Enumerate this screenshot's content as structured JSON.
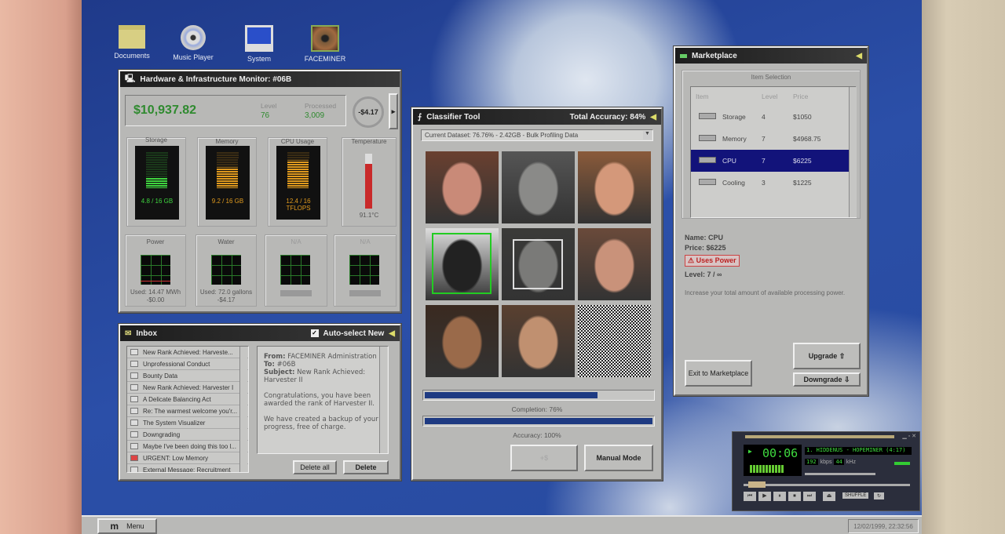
{
  "desktop": {
    "icons": [
      {
        "label": "Documents",
        "icon": "folder-icon"
      },
      {
        "label": "Music Player",
        "icon": "cd-icon"
      },
      {
        "label": "System",
        "icon": "computer-icon"
      },
      {
        "label": "FACEMINER",
        "icon": "eye-icon"
      }
    ]
  },
  "hardware": {
    "title": "Hardware & Infrastructure Monitor: #06B",
    "balance": "$10,937.82",
    "level_label": "Level",
    "level": "76",
    "processed_label": "Processed",
    "processed": "3,009",
    "rate": "-$4.17",
    "meters": [
      {
        "label": "Storage",
        "value": "4.8 / 16 GB",
        "fraction": 0.3,
        "color": "#3fd43f"
      },
      {
        "label": "Memory",
        "value": "9.2 / 16 GB",
        "fraction": 0.575,
        "color": "#e09a1e"
      },
      {
        "label": "CPU Usage",
        "value": "12.4 / 16 TFLOPS",
        "fraction": 0.775,
        "color": "#e09a1e"
      }
    ],
    "temperature": {
      "label": "Temperature",
      "value": "91.1°C",
      "fraction": 0.82
    },
    "graphs": [
      {
        "label": "Power",
        "line1": "Used: 14.47 MWh",
        "line2": "-$0.00"
      },
      {
        "label": "Water",
        "line1": "Used: 72.0 gallons",
        "line2": "-$4.17"
      },
      {
        "label": "N/A"
      },
      {
        "label": "N/A"
      }
    ]
  },
  "inbox": {
    "title": "Inbox",
    "auto_select": "Auto-select New",
    "auto_checked": true,
    "messages": [
      "New Rank Achieved: Harveste...",
      "Unprofessional Conduct",
      "Bounty Data",
      "New Rank Achieved: Harvester I",
      "A Delicate Balancing Act",
      "Re: The warmest welcome you'r...",
      "The System Visualizer",
      "Downgrading",
      "Maybe I've been doing this too l...",
      "URGENT: Low Memory",
      "External Message: Recruitment"
    ],
    "reader": {
      "from_label": "From:",
      "from": "FACEMINER Administration",
      "to_label": "To:",
      "to": "#06B",
      "subject_label": "Subject:",
      "subject": "New Rank Achieved: Harvester II",
      "body1": "Congratulations, you have been awarded the rank of Harvester II.",
      "body2": "We have created a backup of your progress, free of charge."
    },
    "delete_all": "Delete all",
    "delete": "Delete"
  },
  "classifier": {
    "title": "Classifier Tool",
    "accuracy_total": "Total Accuracy: 84%",
    "dataset": "Current Dataset: 76.76% - 2.42GB - Bulk Profiling Data",
    "completion_label": "Completion: 76%",
    "completion": 0.76,
    "accuracy_label": "Accuracy: 100%",
    "accuracy": 1.0,
    "disabled_button": "+$",
    "manual_mode": "Manual Mode"
  },
  "market": {
    "title": "Marketplace",
    "group": "Item Selection",
    "headers": [
      "Item",
      "Level",
      "Price"
    ],
    "items": [
      {
        "name": "Storage",
        "level": "4",
        "price": "$1050",
        "icon": "storage-icon"
      },
      {
        "name": "Memory",
        "level": "7",
        "price": "$4968.75",
        "icon": "memory-icon"
      },
      {
        "name": "CPU",
        "level": "7",
        "price": "$6225",
        "icon": "cpu-icon",
        "selected": true
      },
      {
        "name": "Cooling",
        "level": "3",
        "price": "$1225",
        "icon": "cooling-icon"
      }
    ],
    "detail": {
      "name": "Name: CPU",
      "price": "Price: $6225",
      "warning": "⚠ Uses Power",
      "level": "Level: 7 / ∞",
      "desc": "Increase your total amount of available processing power."
    },
    "exit": "Exit to Marketplace",
    "upgrade": "Upgrade ⇧",
    "downgrade": "Downgrade ⇩"
  },
  "player": {
    "time": "00:06",
    "track": "1. HIDDENUS - HOPEMINER (4:17)",
    "kbps": "192",
    "kbps_unit": "kbps",
    "khz": "44",
    "khz_unit": "kHz",
    "shuffle": "SHUFFLE"
  },
  "taskbar": {
    "menu": "Menu",
    "clock": "12/02/1999, 22:32:56"
  }
}
